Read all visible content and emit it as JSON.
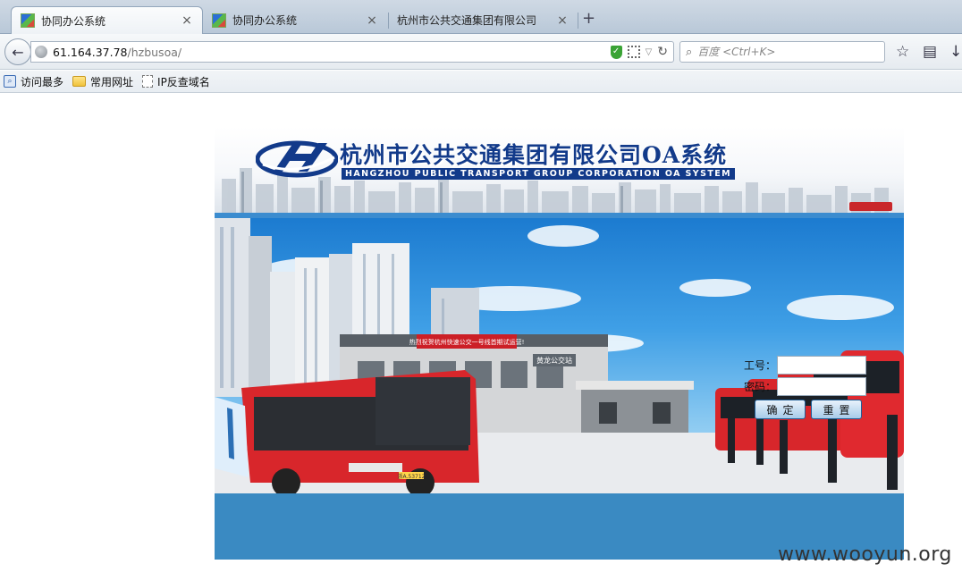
{
  "browser": {
    "tabs": [
      {
        "title": "协同办公系统",
        "active": true
      },
      {
        "title": "协同办公系统",
        "active": false
      },
      {
        "title": "杭州市公共交通集团有限公司",
        "active": false
      }
    ],
    "new_tab_label": "+",
    "close_label": "×",
    "url": {
      "host": "61.164.37.78",
      "path": "/hzbusoa/"
    },
    "search_placeholder": "百度 <Ctrl+K>",
    "bookmarks": [
      {
        "label": "访问最多",
        "icon": "search-page-icon"
      },
      {
        "label": "常用网址",
        "icon": "folder-icon"
      },
      {
        "label": "IP反查域名",
        "icon": "page-icon"
      }
    ]
  },
  "header": {
    "title_cn": "杭州市公共交通集团有限公司OA系统",
    "title_en": "HANGZHOU PUBLIC TRANSPORT GROUP CORPORATION OA SYSTEM",
    "logo": "hangzhou-bus-logo"
  },
  "scene": {
    "banner_text": "热烈祝贺杭州快速公交一号线首期试运营!",
    "station_sign": "黄龙公交站",
    "bus_plate": "浙A.53712"
  },
  "login": {
    "user_label": "工号：",
    "password_label": "密码：",
    "submit_label": "确定",
    "reset_label": "重置"
  },
  "watermark": "www.wooyun.org",
  "colors": {
    "primary": "#123a8a",
    "band": "#3a8ac2",
    "bus_red": "#d8262b"
  }
}
